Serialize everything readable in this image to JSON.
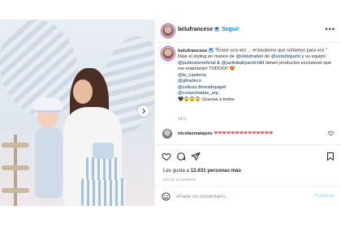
{
  "post": {
    "username": "belufrancese",
    "follow_label": "Seguir",
    "more_label": "•••",
    "dot": "•"
  },
  "caption": {
    "username": "belufrancese",
    "line1": "\"Érase una vez ... el bautismo que soñamos para vos \"",
    "line2_pre": "Deje el styling en manos de ",
    "mention1": "@elidafrattari",
    "line2_mid1": " de ",
    "mention2": "@estudiojazto",
    "line2_mid2": " y su equipo: ",
    "mention3": "@jazttostoreoficial",
    "line2_mid3": " & ",
    "mention4": "@jazttobabyandchild",
    "line2_post": " tienen productos exclusivos que me enamoran! TODOO!! 😍",
    "mention5": "@la_capkeria",
    "mention6": "@gihadeco",
    "mention7": "@celinao.floresdepapel",
    "mention8": "@corazonadas_arg",
    "mention8_suffix": " .",
    "thanks": "Gracias a todos",
    "thanks_emoji": "🖤😱😱😱",
    "timestamp": "14 h"
  },
  "comment": {
    "username": "nicolasmaiques",
    "hearts": "❤❤❤❤❤❤❤❤❤❤❤❤❤❤"
  },
  "stats": {
    "likes_prefix": "Les gusta a",
    "likes_count": "12.631 personas más",
    "age": "HACE 14 HORAS"
  },
  "add_comment": {
    "placeholder": "Añade un comentario...",
    "publish_label": "Publicar"
  },
  "colors": {
    "link": "#00376b",
    "follow": "#0095f6",
    "publish_disabled": "#b2dffc",
    "hearts": "#ed4956"
  }
}
